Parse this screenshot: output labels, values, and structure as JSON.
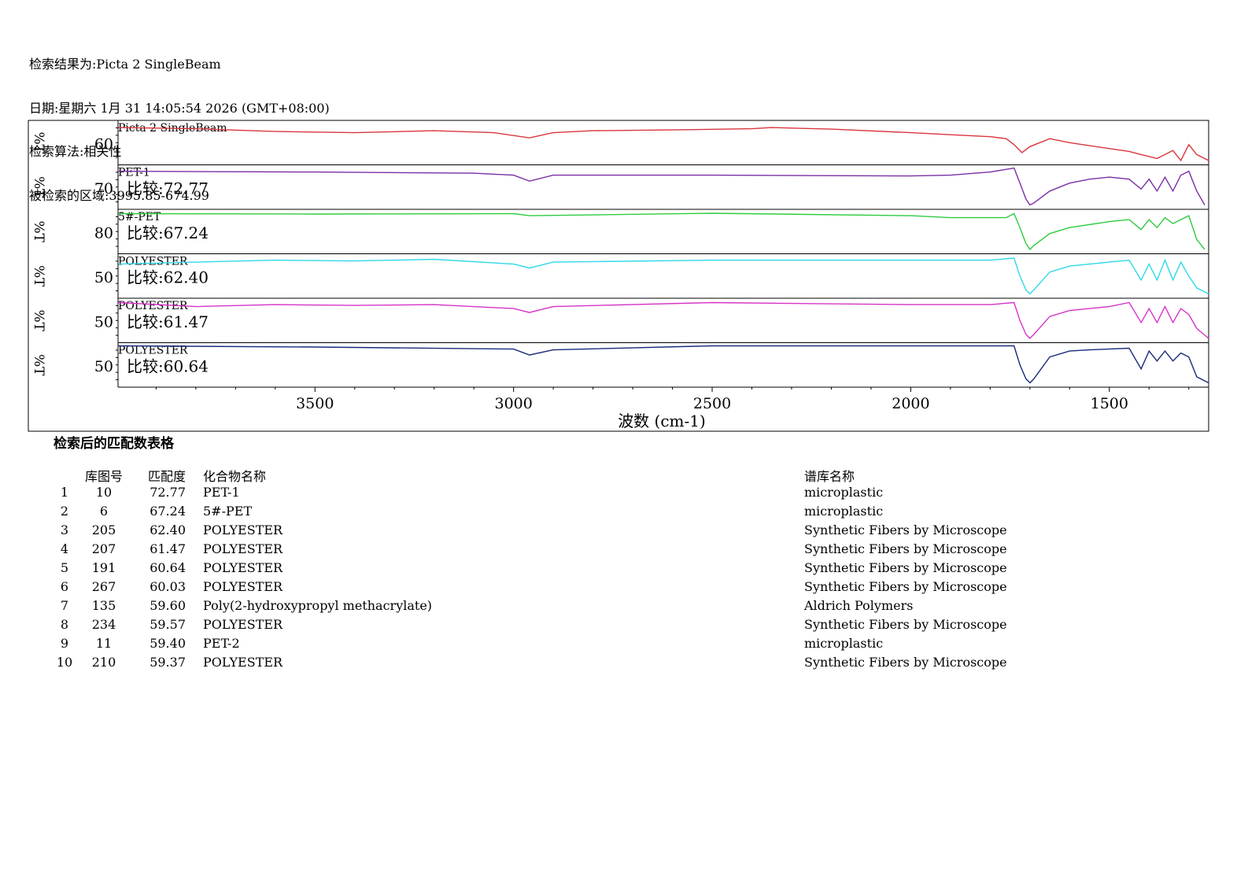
{
  "header": {
    "line1": "检索结果为:Picta 2 SingleBeam",
    "line2": "日期:星期六 1月 31 14:05:54 2026 (GMT+08:00)",
    "line3": "检索算法:相关性",
    "line4": "被检索的区域:3995.85-674.99"
  },
  "chart_data": {
    "type": "line",
    "title": "",
    "xlabel": "波数 (cm-1)",
    "ylabel": "%T",
    "x_ticks": [
      3500,
      3000,
      2500,
      2000,
      1500
    ],
    "xlim": [
      3995.85,
      1250
    ],
    "colors": [
      "#d9363e",
      "#7a2fa6",
      "#2ecc40",
      "#2fd8e8",
      "#d633c8",
      "#1a2a7a"
    ],
    "panels": [
      {
        "name": "Picta 2 SingleBeam",
        "compare": "",
        "y_tick": "60",
        "color": "#d9363e",
        "x": [
          3995,
          3800,
          3600,
          3400,
          3200,
          3050,
          2960,
          2900,
          2800,
          2600,
          2400,
          2350,
          2200,
          2000,
          1900,
          1800,
          1760,
          1740,
          1720,
          1700,
          1650,
          1600,
          1500,
          1450,
          1420,
          1380,
          1340,
          1320,
          1300,
          1280,
          1250
        ],
        "y": [
          0.12,
          0.15,
          0.22,
          0.25,
          0.2,
          0.25,
          0.38,
          0.25,
          0.2,
          0.18,
          0.15,
          0.12,
          0.16,
          0.25,
          0.3,
          0.35,
          0.4,
          0.55,
          0.75,
          0.6,
          0.4,
          0.5,
          0.65,
          0.72,
          0.8,
          0.9,
          0.7,
          0.95,
          0.55,
          0.8,
          0.95
        ]
      },
      {
        "name": "PET-1",
        "compare": "比较:72.77",
        "y_tick": "70",
        "color": "#7a2fa6",
        "x": [
          3995,
          3500,
          3100,
          3000,
          2960,
          2900,
          2500,
          2000,
          1900,
          1800,
          1740,
          1725,
          1710,
          1700,
          1690,
          1650,
          1600,
          1550,
          1500,
          1450,
          1420,
          1400,
          1380,
          1360,
          1340,
          1320,
          1300,
          1280,
          1260
        ],
        "y": [
          0.1,
          0.12,
          0.15,
          0.2,
          0.35,
          0.2,
          0.2,
          0.22,
          0.2,
          0.12,
          0.02,
          0.4,
          0.8,
          0.95,
          0.9,
          0.6,
          0.4,
          0.3,
          0.25,
          0.3,
          0.55,
          0.3,
          0.6,
          0.25,
          0.6,
          0.2,
          0.1,
          0.6,
          0.95
        ]
      },
      {
        "name": "5#-PET",
        "compare": "比较:67.24",
        "y_tick": "80",
        "color": "#2ecc40",
        "x": [
          3995,
          3500,
          3000,
          2960,
          2500,
          2000,
          1900,
          1760,
          1740,
          1725,
          1710,
          1700,
          1690,
          1650,
          1600,
          1500,
          1450,
          1420,
          1400,
          1380,
          1360,
          1340,
          1300,
          1280,
          1260
        ],
        "y": [
          0.05,
          0.06,
          0.05,
          0.1,
          0.04,
          0.1,
          0.15,
          0.15,
          0.05,
          0.4,
          0.8,
          0.95,
          0.85,
          0.55,
          0.4,
          0.25,
          0.2,
          0.45,
          0.2,
          0.4,
          0.15,
          0.3,
          0.1,
          0.7,
          0.95
        ]
      },
      {
        "name": "POLYESTER",
        "compare": "比较:62.40",
        "y_tick": "50",
        "color": "#2fd8e8",
        "x": [
          3995,
          3800,
          3600,
          3400,
          3200,
          3000,
          2960,
          2900,
          2500,
          2000,
          1800,
          1740,
          1725,
          1710,
          1700,
          1690,
          1650,
          1600,
          1550,
          1500,
          1450,
          1420,
          1400,
          1380,
          1360,
          1340,
          1320,
          1300,
          1280,
          1250
        ],
        "y": [
          0.2,
          0.15,
          0.1,
          0.12,
          0.08,
          0.2,
          0.3,
          0.15,
          0.1,
          0.1,
          0.1,
          0.05,
          0.5,
          0.85,
          0.95,
          0.85,
          0.4,
          0.25,
          0.2,
          0.15,
          0.1,
          0.6,
          0.2,
          0.6,
          0.1,
          0.6,
          0.15,
          0.5,
          0.8,
          0.95
        ]
      },
      {
        "name": "POLYESTER",
        "compare": "比较:61.47",
        "y_tick": "50",
        "color": "#d633c8",
        "x": [
          3995,
          3800,
          3600,
          3400,
          3200,
          3000,
          2960,
          2900,
          2500,
          2000,
          1800,
          1740,
          1725,
          1710,
          1700,
          1690,
          1650,
          1600,
          1550,
          1500,
          1450,
          1420,
          1400,
          1380,
          1360,
          1340,
          1320,
          1300,
          1280,
          1250
        ],
        "y": [
          0.05,
          0.15,
          0.1,
          0.12,
          0.1,
          0.2,
          0.3,
          0.15,
          0.05,
          0.1,
          0.1,
          0.05,
          0.5,
          0.85,
          0.95,
          0.85,
          0.4,
          0.25,
          0.2,
          0.15,
          0.05,
          0.55,
          0.2,
          0.55,
          0.15,
          0.55,
          0.2,
          0.35,
          0.7,
          0.95
        ]
      },
      {
        "name": "POLYESTER",
        "compare": "比较:60.64",
        "y_tick": "50",
        "color": "#1a2a7a",
        "x": [
          3995,
          3500,
          3000,
          2960,
          2900,
          2500,
          2000,
          1800,
          1740,
          1725,
          1710,
          1700,
          1690,
          1650,
          1600,
          1550,
          1500,
          1450,
          1420,
          1400,
          1380,
          1360,
          1340,
          1320,
          1300,
          1280,
          1250
        ],
        "y": [
          0.02,
          0.05,
          0.1,
          0.25,
          0.12,
          0.02,
          0.02,
          0.02,
          0.02,
          0.5,
          0.85,
          0.95,
          0.85,
          0.3,
          0.15,
          0.12,
          0.1,
          0.08,
          0.6,
          0.15,
          0.4,
          0.15,
          0.4,
          0.2,
          0.3,
          0.8,
          0.95
        ]
      }
    ]
  },
  "table": {
    "title": "检索后的匹配数表格",
    "headers": {
      "lib": "库图号",
      "score": "匹配度",
      "name": "化合物名称",
      "db": "谱库名称"
    },
    "rows": [
      {
        "idx": "1",
        "lib": "10",
        "score": "72.77",
        "name": "PET-1",
        "db": "microplastic"
      },
      {
        "idx": "2",
        "lib": "6",
        "score": "67.24",
        "name": "5#-PET",
        "db": "microplastic"
      },
      {
        "idx": "3",
        "lib": "205",
        "score": "62.40",
        "name": "POLYESTER",
        "db": "Synthetic Fibers by Microscope"
      },
      {
        "idx": "4",
        "lib": "207",
        "score": "61.47",
        "name": "POLYESTER",
        "db": "Synthetic Fibers by Microscope"
      },
      {
        "idx": "5",
        "lib": "191",
        "score": "60.64",
        "name": "POLYESTER",
        "db": "Synthetic Fibers by Microscope"
      },
      {
        "idx": "6",
        "lib": "267",
        "score": "60.03",
        "name": "POLYESTER",
        "db": "Synthetic Fibers by Microscope"
      },
      {
        "idx": "7",
        "lib": "135",
        "score": "59.60",
        "name": "Poly(2-hydroxypropyl methacrylate)",
        "db": "Aldrich Polymers"
      },
      {
        "idx": "8",
        "lib": "234",
        "score": "59.57",
        "name": "POLYESTER",
        "db": "Synthetic Fibers by Microscope"
      },
      {
        "idx": "9",
        "lib": "11",
        "score": "59.40",
        "name": "PET-2",
        "db": "microplastic"
      },
      {
        "idx": "10",
        "lib": "210",
        "score": "59.37",
        "name": "POLYESTER",
        "db": "Synthetic Fibers by Microscope"
      }
    ]
  }
}
